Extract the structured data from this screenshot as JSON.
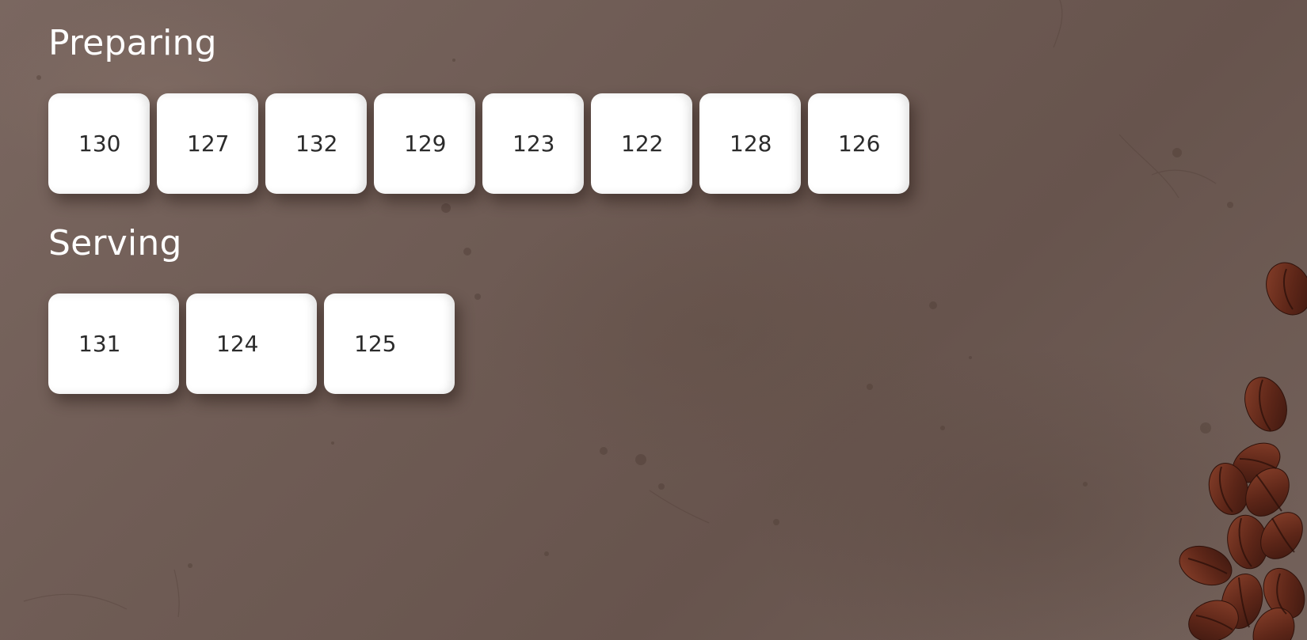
{
  "preparing": {
    "title": "Preparing",
    "orders": [
      "130",
      "127",
      "132",
      "129",
      "123",
      "122",
      "128",
      "126"
    ]
  },
  "serving": {
    "title": "Serving",
    "orders": [
      "131",
      "124",
      "125"
    ]
  },
  "colors": {
    "background": "#6f5c55",
    "ticket": "#ffffff",
    "ticket_text": "#2b2b2b",
    "title_text": "#ffffff",
    "bean": "#6b2e1f"
  },
  "icons": [
    "coffee-beans-decoration"
  ]
}
